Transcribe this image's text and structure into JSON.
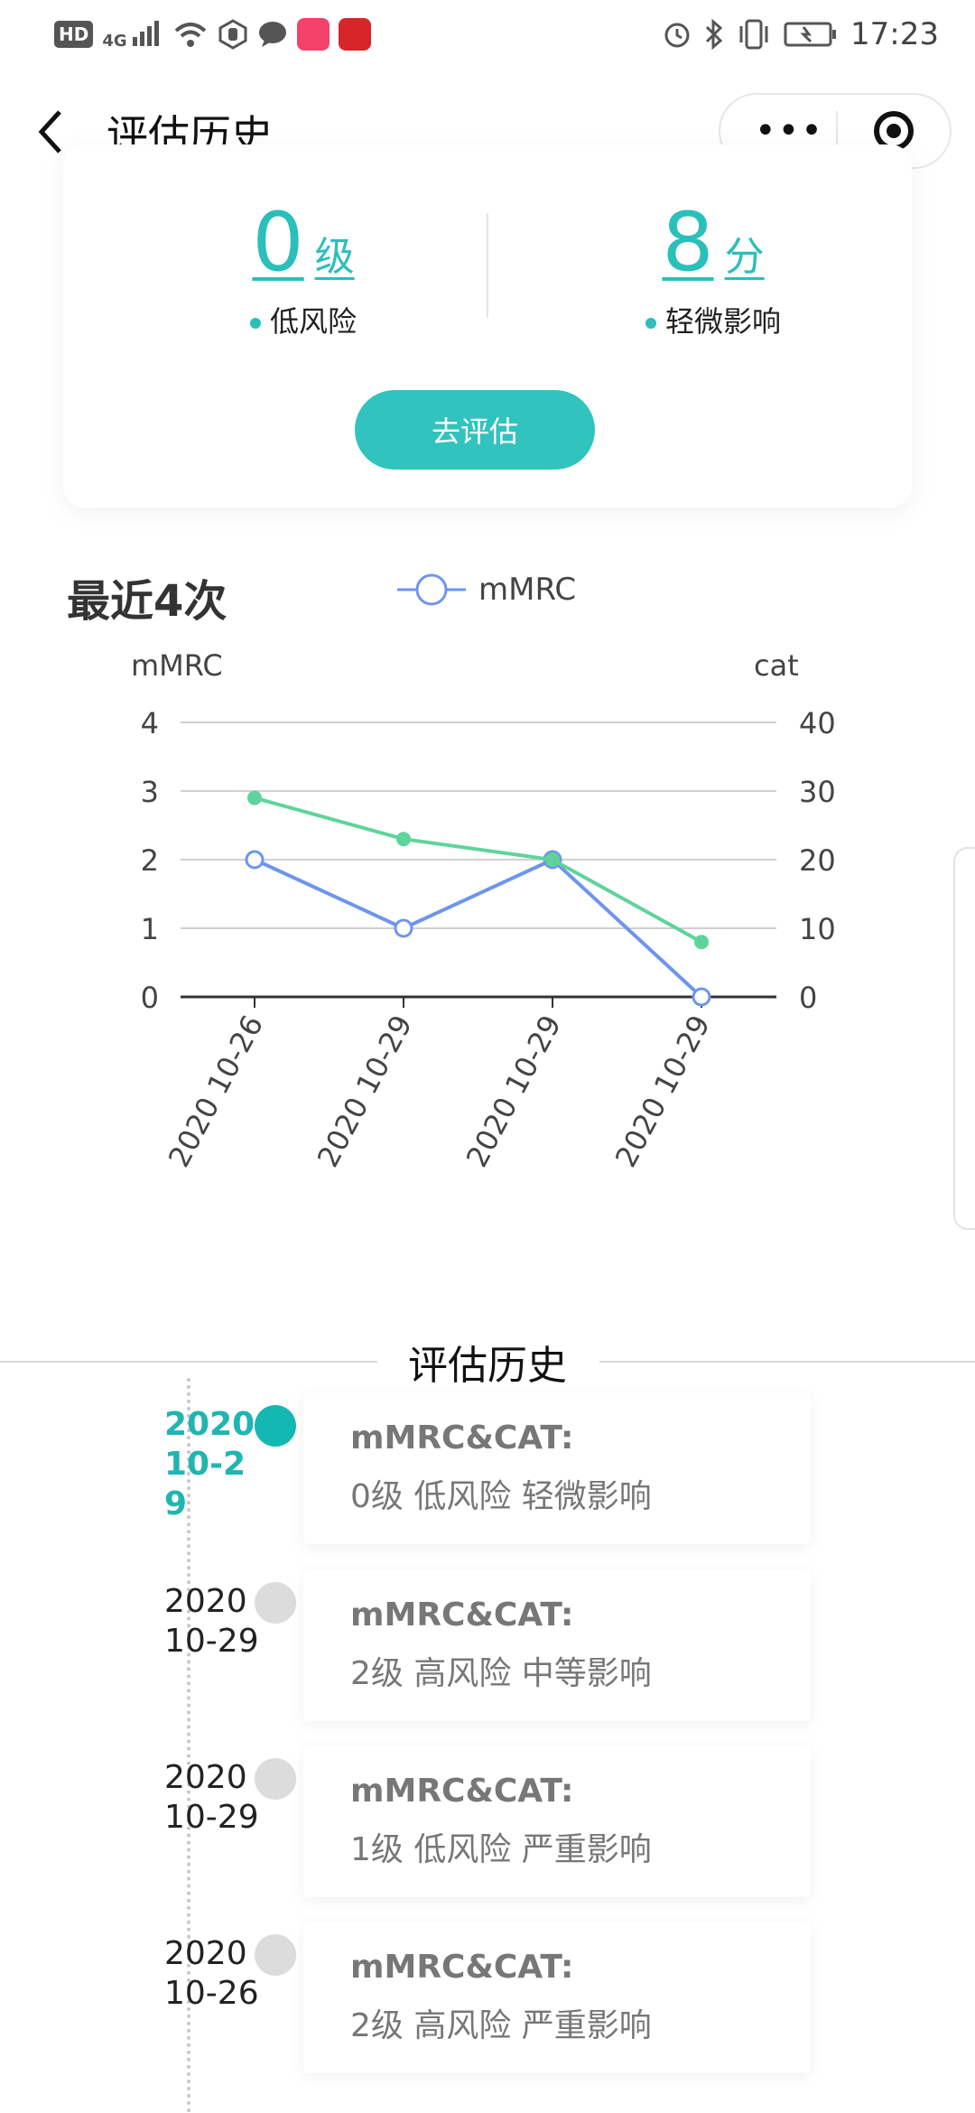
{
  "status_bar": {
    "left_icons": [
      "hd-badge",
      "signal-4g-icon",
      "wifi-icon",
      "hand-icon",
      "chat-bubble-icon",
      "app-icon-1",
      "app-icon-2"
    ],
    "hd": "HD",
    "network": "4G",
    "right_icons": [
      "alarm-icon",
      "bluetooth-icon",
      "vibrate-icon",
      "battery-icon"
    ],
    "time": "17:23"
  },
  "nav": {
    "title": "评估历史",
    "more_icon": "more-dots-icon",
    "close_icon": "target-icon"
  },
  "summary": {
    "level_value": "0",
    "level_unit": "级",
    "level_desc": "低风险",
    "score_value": "8",
    "score_unit": "分",
    "score_desc": "轻微影响",
    "button_label": "去评估"
  },
  "colors": {
    "accent": "#2bbfba",
    "mmrc_line": "#6e95ee",
    "cat_line": "#5fd49a"
  },
  "chart_data": {
    "type": "line",
    "title": "最近4次",
    "categories": [
      "2020 10-26",
      "2020 10-29",
      "2020 10-29",
      "2020 10-29"
    ],
    "series": [
      {
        "name": "mMRC",
        "axis": "left",
        "values": [
          2,
          1,
          2,
          0
        ]
      },
      {
        "axis": "right",
        "values": [
          29,
          23,
          20,
          8
        ]
      }
    ],
    "y_left": {
      "label": "mMRC",
      "ticks": [
        0,
        1,
        2,
        3,
        4
      ],
      "range": [
        0,
        4
      ]
    },
    "y_right": {
      "label": "cat",
      "ticks": [
        0,
        10,
        20,
        30,
        40
      ],
      "range": [
        0,
        40
      ]
    },
    "legend": "top",
    "grid": true
  },
  "history": {
    "title": "评估历史",
    "items": [
      {
        "date": "2020 10-29",
        "header": "mMRC&CAT:",
        "body": "0级 低风险 轻微影响",
        "active": true
      },
      {
        "date": "2020 10-29",
        "header": "mMRC&CAT:",
        "body": "2级 高风险 中等影响",
        "active": false
      },
      {
        "date": "2020 10-29",
        "header": "mMRC&CAT:",
        "body": "1级 低风险 严重影响",
        "active": false
      },
      {
        "date": "2020 10-26",
        "header": "mMRC&CAT:",
        "body": "2级 高风险 严重影响",
        "active": false
      }
    ]
  }
}
